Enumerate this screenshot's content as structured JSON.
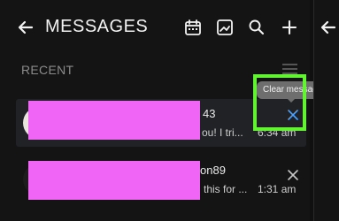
{
  "header": {
    "title": "MESSAGES",
    "icons": [
      "back-arrow-icon",
      "calendar-icon",
      "image-chart-icon",
      "search-icon",
      "plus-icon"
    ]
  },
  "recent": {
    "label": "RECENT",
    "tooltip": "Clear messages"
  },
  "messages": [
    {
      "name_suffix": "43",
      "preview_suffix": "ou! I tri...",
      "time": "6:34 am",
      "active": true
    },
    {
      "name_suffix": "on89",
      "preview_suffix": "this for ...",
      "time": "1:31 am",
      "active": false
    }
  ],
  "colors": {
    "background": "#141414",
    "active_row": "#202225",
    "accent_blue": "#4da3ff",
    "highlight_green": "#63f431",
    "redaction_pink": "#f165f6"
  }
}
